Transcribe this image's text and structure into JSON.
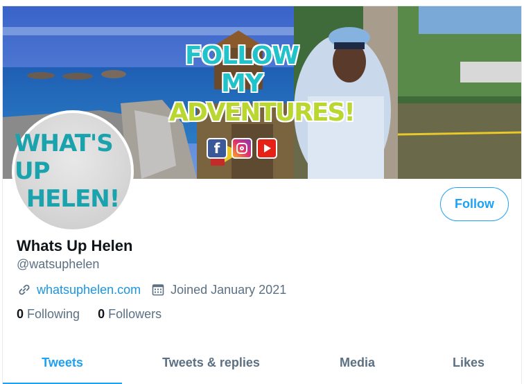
{
  "banner": {
    "headline_line1": "FOLLOW MY",
    "headline_line2": "ADVENTURES!",
    "social_icons": [
      "facebook-icon",
      "instagram-icon",
      "youtube-icon"
    ]
  },
  "avatar": {
    "line1": "WHAT'S UP",
    "line2": "HELEN!"
  },
  "profile": {
    "display_name": "Whats Up Helen",
    "handle": "@watsuphelen",
    "website": "whatsuphelen.com",
    "joined": "Joined January 2021",
    "following_count": "0",
    "following_label": "Following",
    "followers_count": "0",
    "followers_label": "Followers",
    "follow_label": "Follow"
  },
  "tabs": [
    {
      "label": "Tweets",
      "active": true
    },
    {
      "label": "Tweets & replies",
      "active": false
    },
    {
      "label": "Media",
      "active": false
    },
    {
      "label": "Likes",
      "active": false
    }
  ],
  "colors": {
    "accent": "#1da1f2",
    "link": "#1b95e0",
    "secondary_text": "#5b7083",
    "primary_text": "#0f1419"
  }
}
